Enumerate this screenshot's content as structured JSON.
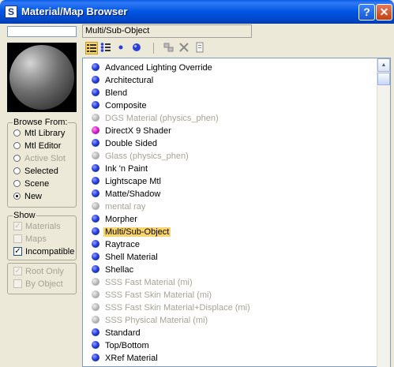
{
  "window": {
    "title": "Material/Map Browser",
    "help_glyph": "?",
    "close_glyph": "✕",
    "icon_glyph": "S"
  },
  "current": {
    "name": "Multi/Sub-Object"
  },
  "browse_from": {
    "label": "Browse From:",
    "options": [
      {
        "label": "Mtl Library",
        "checked": false,
        "enabled": true
      },
      {
        "label": "Mtl Editor",
        "checked": false,
        "enabled": true
      },
      {
        "label": "Active Slot",
        "checked": false,
        "enabled": false
      },
      {
        "label": "Selected",
        "checked": false,
        "enabled": true
      },
      {
        "label": "Scene",
        "checked": false,
        "enabled": true
      },
      {
        "label": "New",
        "checked": true,
        "enabled": true
      }
    ]
  },
  "show": {
    "label": "Show",
    "options": [
      {
        "label": "Materials",
        "checked": true,
        "enabled": false
      },
      {
        "label": "Maps",
        "checked": false,
        "enabled": false
      },
      {
        "label": "Incompatible",
        "checked": true,
        "enabled": true
      }
    ]
  },
  "filters": {
    "options": [
      {
        "label": "Root Only",
        "checked": true,
        "enabled": false
      },
      {
        "label": "By Object",
        "checked": false,
        "enabled": false
      }
    ]
  },
  "toolbar": {
    "list_view_icon": "list-view-icon",
    "list_icons_view_icon": "list-icons-view-icon",
    "small_icons_view_icon": "small-icons-view-icon",
    "large_icons_view_icon": "large-icons-view-icon",
    "update_scene_icon": "update-scene-icon",
    "delete_icon": "delete-icon",
    "clear_icon": "clear-icon"
  },
  "colors": {
    "selection": "#f9d46a",
    "title_bar": "#0054e3",
    "material_ball": "#2b3fd6"
  },
  "materials": [
    {
      "label": "Advanced Lighting Override",
      "icon": "blue",
      "enabled": true,
      "selected": false
    },
    {
      "label": "Architectural",
      "icon": "blue",
      "enabled": true,
      "selected": false
    },
    {
      "label": "Blend",
      "icon": "blue",
      "enabled": true,
      "selected": false
    },
    {
      "label": "Composite",
      "icon": "blue",
      "enabled": true,
      "selected": false
    },
    {
      "label": "DGS Material (physics_phen)",
      "icon": "gray",
      "enabled": false,
      "selected": false
    },
    {
      "label": "DirectX 9 Shader",
      "icon": "magenta",
      "enabled": true,
      "selected": false
    },
    {
      "label": "Double Sided",
      "icon": "blue",
      "enabled": true,
      "selected": false
    },
    {
      "label": "Glass (physics_phen)",
      "icon": "gray",
      "enabled": false,
      "selected": false
    },
    {
      "label": "Ink 'n Paint",
      "icon": "blue",
      "enabled": true,
      "selected": false
    },
    {
      "label": "Lightscape Mtl",
      "icon": "blue",
      "enabled": true,
      "selected": false
    },
    {
      "label": "Matte/Shadow",
      "icon": "blue",
      "enabled": true,
      "selected": false
    },
    {
      "label": "mental ray",
      "icon": "gray",
      "enabled": false,
      "selected": false
    },
    {
      "label": "Morpher",
      "icon": "blue",
      "enabled": true,
      "selected": false
    },
    {
      "label": "Multi/Sub-Object",
      "icon": "blue",
      "enabled": true,
      "selected": true
    },
    {
      "label": "Raytrace",
      "icon": "blue",
      "enabled": true,
      "selected": false
    },
    {
      "label": "Shell Material",
      "icon": "blue",
      "enabled": true,
      "selected": false
    },
    {
      "label": "Shellac",
      "icon": "blue",
      "enabled": true,
      "selected": false
    },
    {
      "label": "SSS Fast Material (mi)",
      "icon": "gray",
      "enabled": false,
      "selected": false
    },
    {
      "label": "SSS Fast Skin Material (mi)",
      "icon": "gray",
      "enabled": false,
      "selected": false
    },
    {
      "label": "SSS Fast Skin Material+Displace (mi)",
      "icon": "gray",
      "enabled": false,
      "selected": false
    },
    {
      "label": "SSS Physical Material (mi)",
      "icon": "gray",
      "enabled": false,
      "selected": false
    },
    {
      "label": "Standard",
      "icon": "blue",
      "enabled": true,
      "selected": false
    },
    {
      "label": "Top/Bottom",
      "icon": "blue",
      "enabled": true,
      "selected": false
    },
    {
      "label": "XRef Material",
      "icon": "blue",
      "enabled": true,
      "selected": false
    }
  ]
}
